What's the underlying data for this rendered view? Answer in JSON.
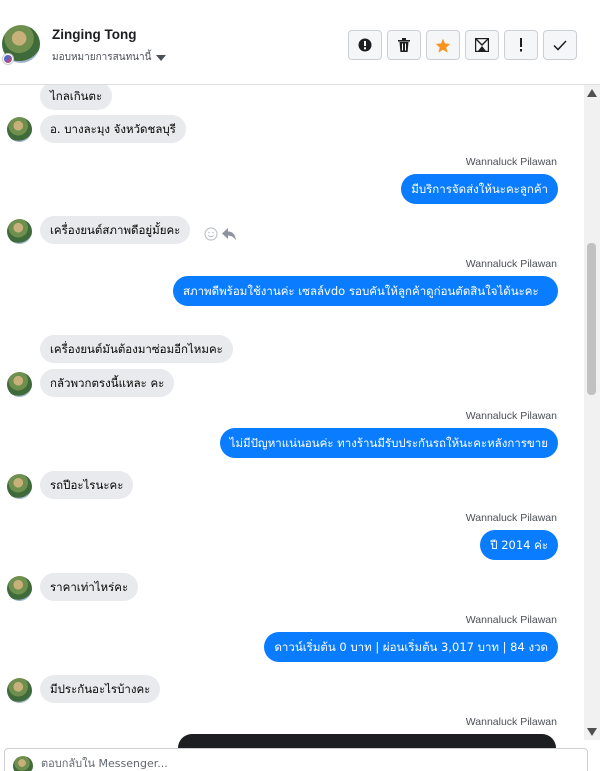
{
  "header": {
    "contact_name": "Zinging Tong",
    "assign_label": "มอบหมายการสนทนานี้"
  },
  "actions": [
    {
      "name": "report-spam",
      "icon": "exclamation-circle-icon"
    },
    {
      "name": "delete",
      "icon": "trash-icon"
    },
    {
      "name": "star",
      "icon": "star-icon",
      "color": "#f7931e"
    },
    {
      "name": "mark-unread",
      "icon": "envelope-x-icon"
    },
    {
      "name": "follow-up",
      "icon": "exclamation-icon"
    },
    {
      "name": "done",
      "icon": "check-icon"
    }
  ],
  "messages": [
    {
      "side": "in",
      "text": "ไกลเกินตะ"
    },
    {
      "side": "in",
      "text": "อ. บางละมุง จังหวัดชลบุรี"
    },
    {
      "side": "out",
      "sender": "Wannaluck Pilawan",
      "text": "มีบริการจัดส่งให้นะคะลูกค้า"
    },
    {
      "side": "in",
      "text": "เครื่องยนต์สภาพดีอยู่มั้ยคะ"
    },
    {
      "side": "out",
      "sender": "Wannaluck Pilawan",
      "text": "สภาพดีพร้อมใช้งานค่ะ  เซลล์vdo รอบคันให้ลูกค้าดูก่อนตัดสินใจได้นะคะ"
    },
    {
      "side": "in",
      "text": "เครื่องยนต์มันต้องมาซ่อมอีกไหมคะ"
    },
    {
      "side": "in",
      "text": "กลัวพวกตรงนี้แหละ คะ"
    },
    {
      "side": "out",
      "sender": "Wannaluck Pilawan",
      "text": "ไม่มีปัญหาแน่นอนค่ะ  ทางร้านมีรับประกันรถให้นะคะหลังการขาย"
    },
    {
      "side": "in",
      "text": "รถปีอะไรนะคะ"
    },
    {
      "side": "out",
      "sender": "Wannaluck Pilawan",
      "text": "ปี 2014  ค่ะ"
    },
    {
      "side": "in",
      "text": "ราคาเท่าไหร่คะ"
    },
    {
      "side": "out",
      "sender": "Wannaluck Pilawan",
      "text": "ดาวน์เริ่มต้น 0 บาท | ผ่อนเริ่มต้น 3,017 บาท | 84 งวด"
    },
    {
      "side": "in",
      "text": "มีประกันอะไรบ้างคะ"
    },
    {
      "side": "out",
      "sender": "Wannaluck Pilawan",
      "text": ""
    }
  ],
  "reactions": {
    "icons": [
      "smile-icon",
      "reply-icon"
    ]
  },
  "composer": {
    "placeholder": "ตอบกลับใน Messenger..."
  }
}
